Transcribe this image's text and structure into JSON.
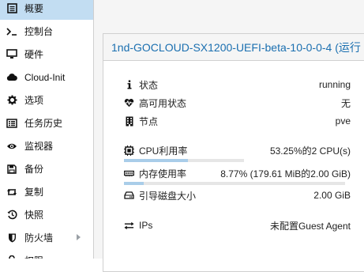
{
  "sidebar": {
    "items": [
      {
        "label": "概要",
        "icon": "book-icon"
      },
      {
        "label": "控制台",
        "icon": "terminal-icon"
      },
      {
        "label": "硬件",
        "icon": "monitor-icon"
      },
      {
        "label": "Cloud-Init",
        "icon": "cloud-icon"
      },
      {
        "label": "选项",
        "icon": "gear-icon"
      },
      {
        "label": "任务历史",
        "icon": "list-icon"
      },
      {
        "label": "监视器",
        "icon": "eye-icon"
      },
      {
        "label": "备份",
        "icon": "floppy-icon"
      },
      {
        "label": "复制",
        "icon": "retweet-icon"
      },
      {
        "label": "快照",
        "icon": "history-icon"
      },
      {
        "label": "防火墙",
        "icon": "shield-icon"
      },
      {
        "label": "权限",
        "icon": "unlock-icon"
      }
    ],
    "active_index": 0,
    "active_bg": "#c2ddf2"
  },
  "panel": {
    "title": "1nd-GOCLOUD-SX1200-UEFI-beta-10-0-0-4 (运行",
    "title_color": "#1a6fb0"
  },
  "status": {
    "status_label": "状态",
    "status_value": "running",
    "ha_label": "高可用状态",
    "ha_value": "无",
    "node_label": "节点",
    "node_value": "pve",
    "cpu_label": "CPU利用率",
    "cpu_value": "53.25%的2 CPU(s)",
    "cpu_fraction": 0.5325,
    "mem_label": "内存使用率",
    "mem_value": "8.77% (179.61 MiB的2.00 GiB)",
    "mem_fraction": 0.0877,
    "disk_label": "引导磁盘大小",
    "disk_value": "2.00 GiB",
    "ips_label": "IPs",
    "ips_value": "未配置Guest Agent",
    "bar_color": "#a9cde9"
  }
}
